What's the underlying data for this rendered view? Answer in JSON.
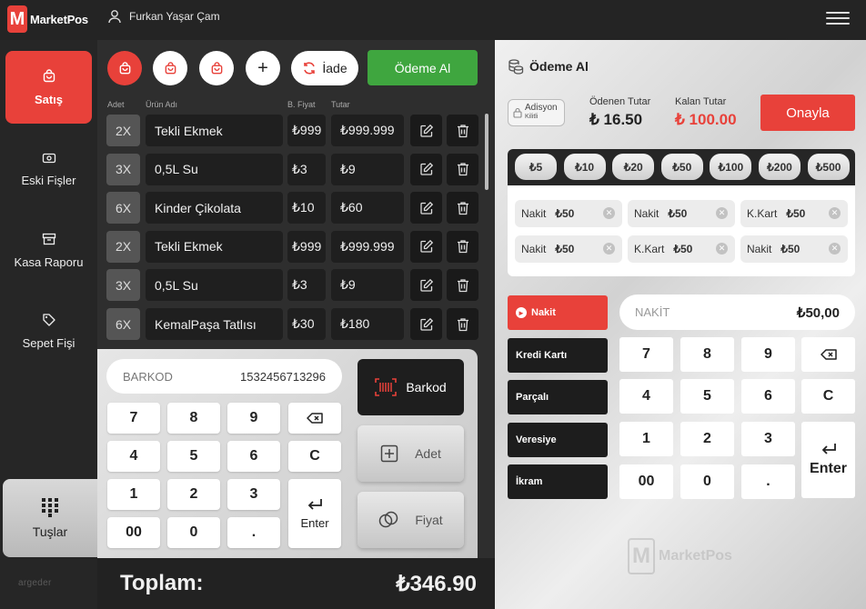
{
  "app": {
    "logo_letter": "M",
    "logo_text": "MarketPos",
    "user_name": "Furkan Yaşar Çam",
    "brand_footer": "argeder"
  },
  "colors": {
    "accent": "#e8413a",
    "success": "#3fa63f",
    "dark": "#262626"
  },
  "sidebar": {
    "items": [
      {
        "label": "Satış",
        "icon": "basket-icon",
        "active": true
      },
      {
        "label": "Eski Fişler",
        "icon": "receipt-icon"
      },
      {
        "label": "Kasa Raporu",
        "icon": "cash-register-icon"
      },
      {
        "label": "Sepet Fişi",
        "icon": "tag-icon"
      }
    ],
    "tuslar": "Tuşlar"
  },
  "toolbar": {
    "iade_label": "İade",
    "odeme_label": "Ödeme Al",
    "add_symbol": "+"
  },
  "columns": {
    "qty": "Adet",
    "name": "Ürün Adı",
    "price": "B. Fiyat",
    "total": "Tutar"
  },
  "cart": [
    {
      "qty": "2X",
      "name": "Tekli Ekmek",
      "price": "₺999",
      "total": "₺999.999"
    },
    {
      "qty": "3X",
      "name": "0,5L Su",
      "price": "₺3",
      "total": "₺9"
    },
    {
      "qty": "6X",
      "name": "Kinder Çikolata",
      "price": "₺10",
      "total": "₺60"
    },
    {
      "qty": "2X",
      "name": "Tekli Ekmek",
      "price": "₺999",
      "total": "₺999.999"
    },
    {
      "qty": "3X",
      "name": "0,5L Su",
      "price": "₺3",
      "total": "₺9"
    },
    {
      "qty": "6X",
      "name": "KemalPaşa Tatlısı",
      "price": "₺30",
      "total": "₺180"
    }
  ],
  "barcode": {
    "label": "BARKOD",
    "value": "1532456713296"
  },
  "keypad": {
    "keys": [
      "7",
      "8",
      "9",
      "4",
      "5",
      "6",
      "1",
      "2",
      "3",
      "00",
      "0",
      "."
    ],
    "clear": "C",
    "enter": "Enter"
  },
  "actions": {
    "barkod": "Barkod",
    "adet": "Adet",
    "fiyat": "Fiyat"
  },
  "totals": {
    "label": "Toplam:",
    "value": "₺346.90"
  },
  "payment": {
    "title": "Ödeme Al",
    "adisyon": "Adisyon",
    "adisyon_sub": "Kilitli",
    "paid_label": "Ödenen Tutar",
    "paid_value": "₺ 16.50",
    "remaining_label": "Kalan Tutar",
    "remaining_value": "₺ 100.00",
    "confirm": "Onayla",
    "denominations": [
      "₺5",
      "₺10",
      "₺20",
      "₺50",
      "₺100",
      "₺200",
      "₺500"
    ],
    "entries": [
      {
        "type": "Nakit",
        "amount": "₺50"
      },
      {
        "type": "Nakit",
        "amount": "₺50"
      },
      {
        "type": "K.Kart",
        "amount": "₺50"
      },
      {
        "type": "Nakit",
        "amount": "₺50"
      },
      {
        "type": "K.Kart",
        "amount": "₺50"
      },
      {
        "type": "Nakit",
        "amount": "₺50"
      }
    ],
    "methods": [
      "Nakit",
      "Kredi Kartı",
      "Parçalı",
      "Veresiye",
      "İkram"
    ],
    "input_label": "NAKİT",
    "input_value": "₺50,00",
    "keys": [
      "7",
      "8",
      "9",
      "4",
      "5",
      "6",
      "1",
      "2",
      "3",
      "00",
      "0",
      "."
    ],
    "clear": "C",
    "enter": "Enter",
    "watermark_letter": "M",
    "watermark_text": "MarketPos"
  }
}
